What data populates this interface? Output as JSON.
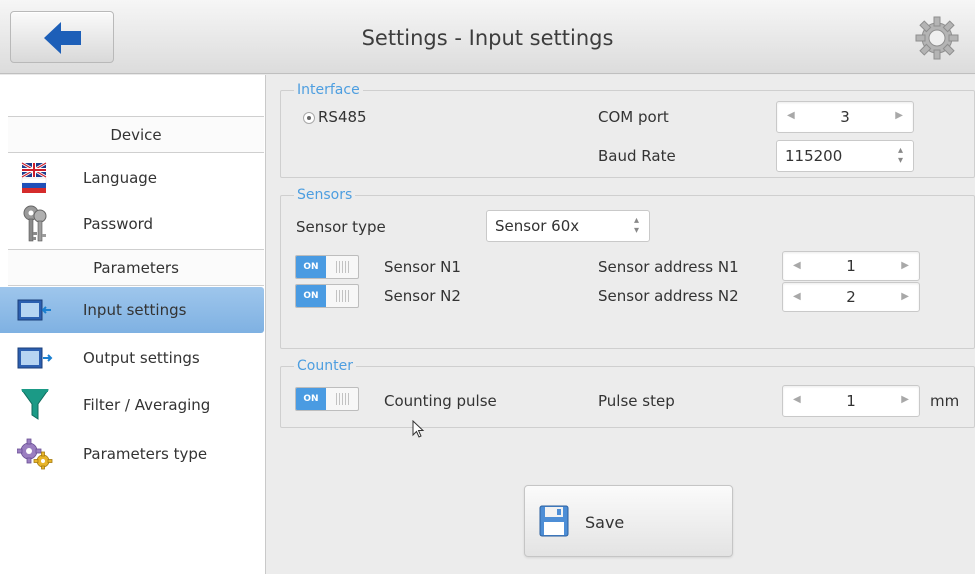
{
  "header": {
    "title": "Settings - Input settings",
    "back_icon": "arrow-left-icon",
    "settings_icon": "gear-icon"
  },
  "sidebar": {
    "sections": [
      {
        "label": "Device"
      },
      {
        "label": "Parameters"
      }
    ],
    "items": [
      {
        "label": "Language",
        "icon": "flags-icon"
      },
      {
        "label": "Password",
        "icon": "keys-icon"
      },
      {
        "label": "Input settings",
        "icon": "monitor-input-icon",
        "active": true
      },
      {
        "label": "Output settings",
        "icon": "monitor-output-icon"
      },
      {
        "label": "Filter / Averaging",
        "icon": "funnel-icon"
      },
      {
        "label": "Parameters type",
        "icon": "gears-icon"
      }
    ]
  },
  "interface": {
    "legend": "Interface",
    "radio_label": "RS485",
    "com_port_label": "COM port",
    "com_port_value": "3",
    "baud_label": "Baud Rate",
    "baud_value": "115200"
  },
  "sensors": {
    "legend": "Sensors",
    "type_label": "Sensor type",
    "type_value": "Sensor 60x",
    "rows": [
      {
        "toggle": "ON",
        "name": "Sensor N1",
        "addr_label": "Sensor address N1",
        "addr_value": "1"
      },
      {
        "toggle": "ON",
        "name": "Sensor N2",
        "addr_label": "Sensor address N2",
        "addr_value": "2"
      }
    ]
  },
  "counter": {
    "legend": "Counter",
    "toggle": "ON",
    "label": "Counting pulse",
    "step_label": "Pulse step",
    "step_value": "1",
    "unit": "mm"
  },
  "save_label": "Save",
  "colors": {
    "accent": "#4a9be2",
    "active_item": "#8fbce8",
    "legend": "#4d9ee0"
  }
}
